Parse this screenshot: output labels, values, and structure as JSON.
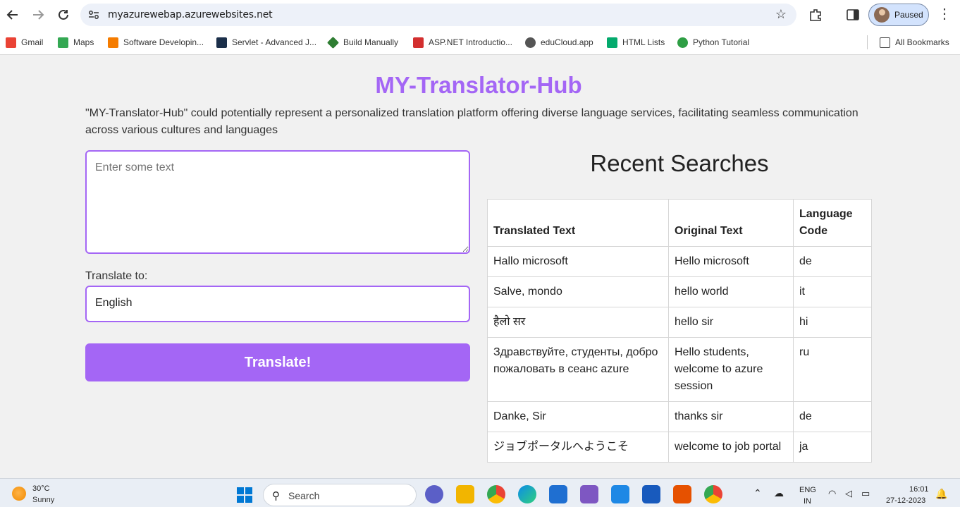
{
  "browser": {
    "url": "myazurewebap.azurewebsites.net",
    "profile_label": "Paused",
    "bookmarks": [
      {
        "label": "Gmail",
        "color": "#ea4335"
      },
      {
        "label": "Maps",
        "color": "#34a853"
      },
      {
        "label": "Software Developin...",
        "color": "#f57c00"
      },
      {
        "label": "Servlet - Advanced J...",
        "color": "#1b2f4a"
      },
      {
        "label": "Build Manually",
        "color": "#2e7d32"
      },
      {
        "label": "ASP.NET Introductio...",
        "color": "#d32f2f"
      },
      {
        "label": "eduCloud.app",
        "color": "#555555"
      },
      {
        "label": "HTML Lists",
        "color": "#04aa6d"
      },
      {
        "label": "Python Tutorial",
        "color": "#2e9e44"
      }
    ],
    "all_bookmarks_label": "All Bookmarks"
  },
  "page": {
    "title": "MY-Translator-Hub",
    "description": "\"MY-Translator-Hub\" could potentially represent a personalized translation platform offering diverse language services, facilitating seamless communication across various cultures and languages",
    "text_placeholder": "Enter some text",
    "translate_to_label": "Translate to:",
    "selected_language": "English",
    "translate_button": "Translate!",
    "recent_title": "Recent Searches",
    "table_headers": [
      "Translated Text",
      "Original Text",
      "Language Code"
    ],
    "rows": [
      {
        "translated": "Hallo microsoft",
        "original": "Hello microsoft",
        "code": "de"
      },
      {
        "translated": "Salve, mondo",
        "original": "hello world",
        "code": "it"
      },
      {
        "translated": "हैलो सर",
        "original": "hello sir",
        "code": "hi"
      },
      {
        "translated": "Здравствуйте, студенты, добро пожаловать в сеанс azure",
        "original": "Hello students, welcome to azure session",
        "code": "ru"
      },
      {
        "translated": "Danke, Sir",
        "original": "thanks sir",
        "code": "de"
      },
      {
        "translated": "ジョブポータルへようこそ",
        "original": "welcome to job portal",
        "code": "ja"
      }
    ],
    "accent_color": "#a466f5"
  },
  "taskbar": {
    "weather_temp": "30°C",
    "weather_desc": "Sunny",
    "search_placeholder": "Search",
    "lang_top": "ENG",
    "lang_bottom": "IN",
    "time": "16:01",
    "date": "27-12-2023"
  }
}
